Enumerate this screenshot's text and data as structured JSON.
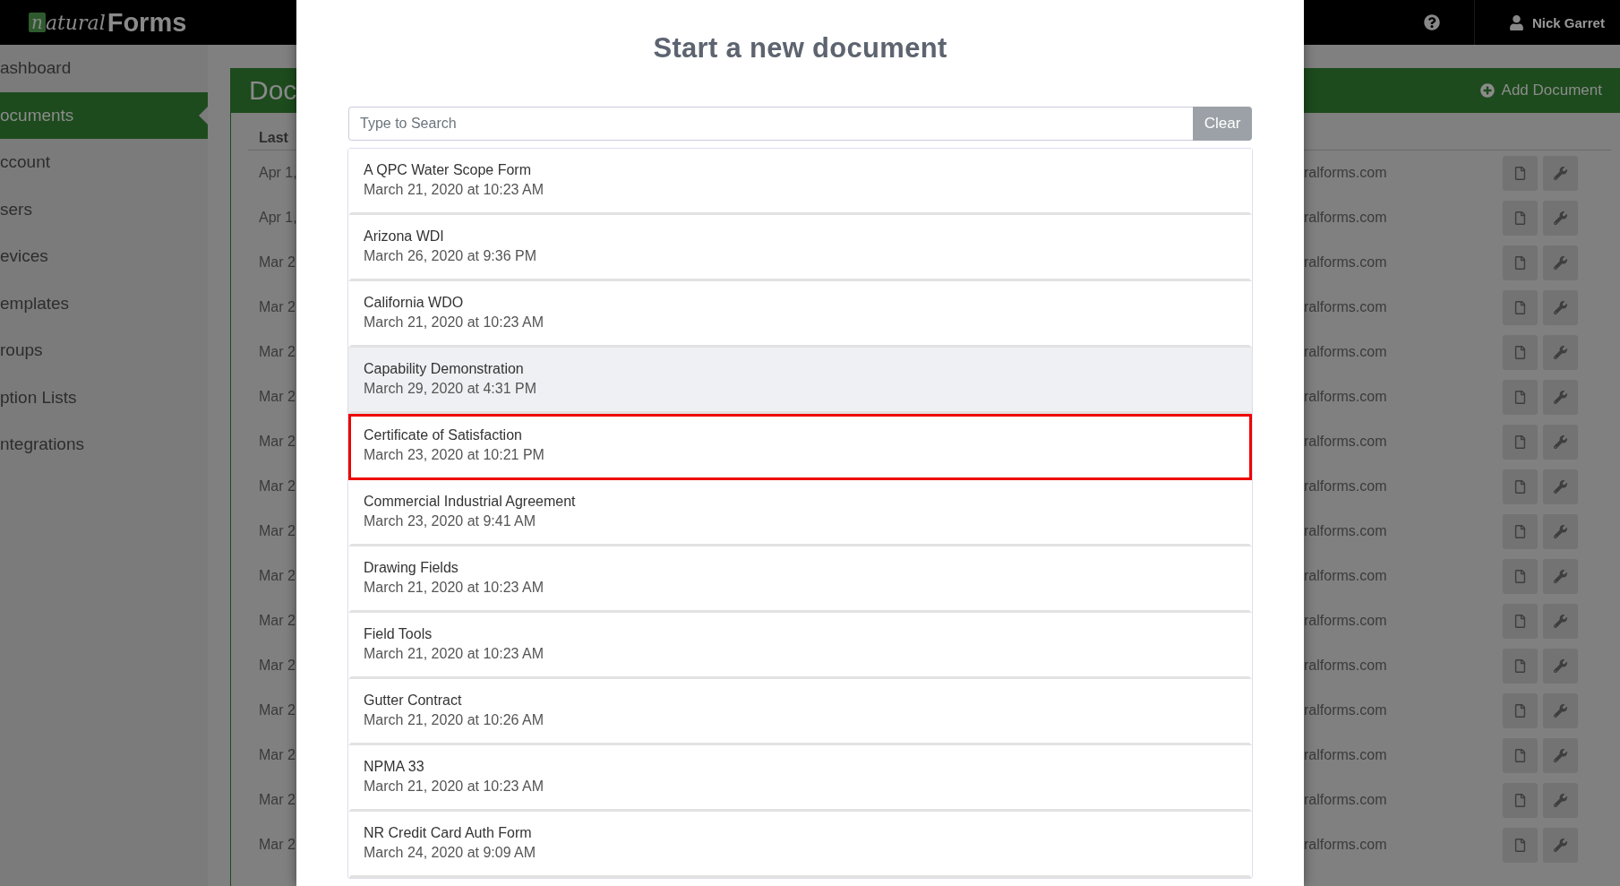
{
  "header": {
    "logo": {
      "mark": "n",
      "script": "atural",
      "wordmark": "Forms"
    },
    "user": "Nick Garret"
  },
  "sidebar": {
    "items": [
      {
        "label": "ashboard",
        "selected": false
      },
      {
        "label": "ocuments",
        "selected": true
      },
      {
        "label": "ccount",
        "selected": false
      },
      {
        "label": "sers",
        "selected": false
      },
      {
        "label": "evices",
        "selected": false
      },
      {
        "label": "emplates",
        "selected": false
      },
      {
        "label": "roups",
        "selected": false
      },
      {
        "label": "ption Lists",
        "selected": false
      },
      {
        "label": "ntegrations",
        "selected": false
      }
    ]
  },
  "panel": {
    "title": "Doc",
    "action": "Add Document",
    "table": {
      "columns": [
        "Last"
      ],
      "rows": [
        {
          "date": "Apr 1,",
          "email": "ralforms.com"
        },
        {
          "date": "Apr 1,",
          "email": "ralforms.com"
        },
        {
          "date": "Mar 2",
          "email": "ralforms.com"
        },
        {
          "date": "Mar 2",
          "email": "ralforms.com"
        },
        {
          "date": "Mar 2",
          "email": "ralforms.com"
        },
        {
          "date": "Mar 2",
          "email": "ralforms.com"
        },
        {
          "date": "Mar 2",
          "email": "ralforms.com"
        },
        {
          "date": "Mar 2",
          "email": "ralforms.com"
        },
        {
          "date": "Mar 2",
          "email": "ralforms.com"
        },
        {
          "date": "Mar 2",
          "email": "ralforms.com"
        },
        {
          "date": "Mar 2",
          "email": "ralforms.com"
        },
        {
          "date": "Mar 2",
          "email": "ralforms.com"
        },
        {
          "date": "Mar 2",
          "email": "ralforms.com"
        },
        {
          "date": "Mar 2",
          "email": "ralforms.com"
        },
        {
          "date": "Mar 2",
          "email": "ralforms.com"
        },
        {
          "date": "Mar 2",
          "email": "ralforms.com"
        }
      ]
    }
  },
  "modal": {
    "title": "Start a new document",
    "search": {
      "placeholder": "Type to Search",
      "button": "Clear"
    },
    "items": [
      {
        "name": "A QPC Water Scope Form",
        "date": "March 21, 2020 at 10:23 AM",
        "selected": false,
        "hovered": false
      },
      {
        "name": "Arizona WDI",
        "date": "March 26, 2020 at 9:36 PM",
        "selected": false,
        "hovered": false
      },
      {
        "name": "California WDO",
        "date": "March 21, 2020 at 10:23 AM",
        "selected": false,
        "hovered": false
      },
      {
        "name": "Capability Demonstration",
        "date": "March 29, 2020 at 4:31 PM",
        "selected": false,
        "hovered": true
      },
      {
        "name": "Certificate of Satisfaction",
        "date": "March 23, 2020 at 10:21 PM",
        "selected": true,
        "hovered": false
      },
      {
        "name": "Commercial Industrial Agreement",
        "date": "March 23, 2020 at 9:41 AM",
        "selected": false,
        "hovered": false
      },
      {
        "name": "Drawing Fields",
        "date": "March 21, 2020 at 10:23 AM",
        "selected": false,
        "hovered": false
      },
      {
        "name": "Field Tools",
        "date": "March 21, 2020 at 10:23 AM",
        "selected": false,
        "hovered": false
      },
      {
        "name": "Gutter Contract",
        "date": "March 21, 2020 at 10:26 AM",
        "selected": false,
        "hovered": false
      },
      {
        "name": "NPMA 33",
        "date": "March 21, 2020 at 10:23 AM",
        "selected": false,
        "hovered": false
      },
      {
        "name": "NR Credit Card Auth Form",
        "date": "March 24, 2020 at 9:09 AM",
        "selected": false,
        "hovered": false
      }
    ]
  }
}
